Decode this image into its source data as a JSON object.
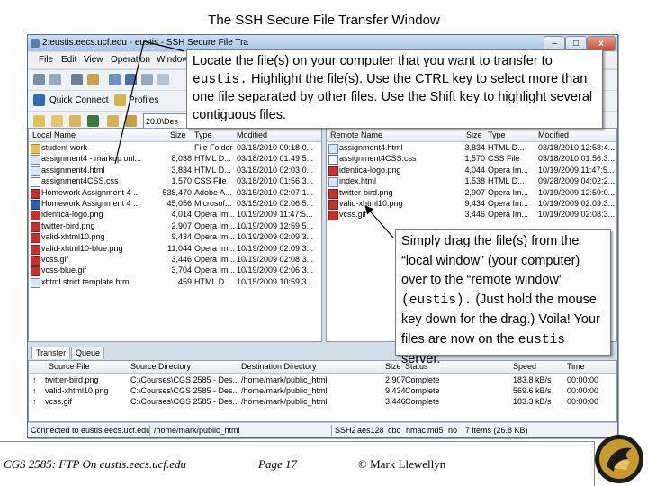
{
  "slide_title": "The SSH Secure File Transfer Window",
  "window": {
    "title": "2:eustis.eecs.ucf.edu - eustis - SSH Secure File Tra",
    "min": "–",
    "max": "□",
    "close": "x"
  },
  "menu": [
    "File",
    "Edit",
    "View",
    "Operation",
    "Window"
  ],
  "toolbar": {
    "quick_connect": "Quick Connect",
    "profiles": "Profiles",
    "path_value": "20.0\\Des"
  },
  "local_pane": {
    "headers": [
      "Local Name",
      "Size",
      "Type",
      "Modified"
    ],
    "rows": [
      {
        "icon": "folder-icon",
        "name": "student work",
        "size": "",
        "type": "File Folder",
        "modified": "03/18/2010 09:18:0..."
      },
      {
        "icon": "html-file-icon",
        "name": "assignment4 - markup onl...",
        "size": "8,038",
        "type": "HTML D...",
        "modified": "03/18/2010 01:49:5..."
      },
      {
        "icon": "html-file-icon",
        "name": "assignment4.html",
        "size": "3,834",
        "type": "HTML D...",
        "modified": "03/18/2010 02:03:0..."
      },
      {
        "icon": "css-file-icon",
        "name": "assignment4CSS.css",
        "size": "1,570",
        "type": "CSS File",
        "modified": "03/18/2010 01:56:3..."
      },
      {
        "icon": "pdf-file-icon",
        "name": "Homework Assignment 4 ...",
        "size": "538,470",
        "type": "Adobe A...",
        "modified": "03/15/2010 02:07:1..."
      },
      {
        "icon": "doc-file-icon",
        "name": "Homework Assignment 4 ...",
        "size": "45,056",
        "type": "Microsof...",
        "modified": "03/15/2010 02:06:5..."
      },
      {
        "icon": "image-file-icon",
        "name": "identica-logo.png",
        "size": "4,014",
        "type": "Opera Im...",
        "modified": "10/19/2009 11:47:5..."
      },
      {
        "icon": "image-file-icon",
        "name": "twitter-bird.png",
        "size": "2,907",
        "type": "Opera Im...",
        "modified": "10/19/2009 12:59:5..."
      },
      {
        "icon": "image-file-icon",
        "name": "valid-xhtml10.png",
        "size": "9,434",
        "type": "Opera Im...",
        "modified": "10/19/2009 02:09:3..."
      },
      {
        "icon": "image-file-icon",
        "name": "valid-xhtml10-blue.png",
        "size": "11,044",
        "type": "Opera Im...",
        "modified": "10/19/2009 02:09:3..."
      },
      {
        "icon": "image-file-icon",
        "name": "vcss.gif",
        "size": "3,446",
        "type": "Opera Im...",
        "modified": "10/19/2009 02:08:3..."
      },
      {
        "icon": "image-file-icon",
        "name": "vcss-blue.gif",
        "size": "3,704",
        "type": "Opera Im...",
        "modified": "10/19/2009 02:06:3..."
      },
      {
        "icon": "html-file-icon",
        "name": "xhtml strict template.html",
        "size": "459",
        "type": "HTML D...",
        "modified": "10/15/2009 10:59:3..."
      }
    ]
  },
  "remote_pane": {
    "headers": [
      "Remote Name",
      "Size",
      "Type",
      "Modified"
    ],
    "rows": [
      {
        "icon": "html-file-icon",
        "name": "assignment4.html",
        "size": "3,834",
        "type": "HTML D...",
        "modified": "03/18/2010 12:58:4..."
      },
      {
        "icon": "css-file-icon",
        "name": "assignment4CSS.css",
        "size": "1,570",
        "type": "CSS File",
        "modified": "03/18/2010 01:56:3..."
      },
      {
        "icon": "image-file-icon",
        "name": "identica-logo.png",
        "size": "4,044",
        "type": "Opera Im...",
        "modified": "10/19/2009 11:47:5..."
      },
      {
        "icon": "html-file-icon",
        "name": "index.html",
        "size": "1,538",
        "type": "HTML D...",
        "modified": "09/28/2009 04:02:2..."
      },
      {
        "icon": "image-file-icon",
        "name": "twitter-bird.png",
        "size": "2,907",
        "type": "Opera Im...",
        "modified": "10/19/2009 12:59:0..."
      },
      {
        "icon": "image-file-icon",
        "name": "valid-xhtml10.png",
        "size": "9,434",
        "type": "Opera Im...",
        "modified": "10/19/2009 02:09:3..."
      },
      {
        "icon": "image-file-icon",
        "name": "vcss.gif",
        "size": "3,446",
        "type": "Opera Im...",
        "modified": "10/19/2009 02:08:3..."
      }
    ]
  },
  "transfer_tabs": [
    "Transfer",
    "Queue"
  ],
  "transfer_pane": {
    "headers": [
      "Source File",
      "Source Directory",
      "Destination Directory",
      "Size",
      "Status",
      "Speed",
      "Time"
    ],
    "rows": [
      {
        "file": "twitter-bird.png",
        "src": "C:\\Courses\\CGS 2585 - Des...",
        "dest": "/home/mark/public_html",
        "size": "2,907",
        "status": "Complete",
        "speed": "183.8 kB/s",
        "time": "00:00:00"
      },
      {
        "file": "valid-xhtml10.png",
        "src": "C:\\Courses\\CGS 2585 - Des...",
        "dest": "/home/mark/public_html",
        "size": "9,434",
        "status": "Complete",
        "speed": "569.6 kB/s",
        "time": "00:00:00"
      },
      {
        "file": "vcss.gif",
        "src": "C:\\Courses\\CGS 2585 - Des...",
        "dest": "/home/mark/public_html",
        "size": "3,446",
        "status": "Complete",
        "speed": "183.3 kB/s",
        "time": "00:00:00"
      }
    ]
  },
  "status_bar": {
    "connection": "Connected to eustis.eecs.ucf.edu",
    "path": "/home/mark/public_html",
    "protocol": "SSH2",
    "cipher": "aes128",
    "mode": "cbc",
    "mac": "hmac",
    "hash": "md5",
    "compression": "no",
    "items": "7 items (26.8 KB)"
  },
  "callout1": {
    "line1": "Locate the file(s) on your computer that you want to transfer to",
    "mono1": "eustis.",
    "rest1": " Highlight the file(s).  Use the CTRL key to select more than one file separated by other files.  Use the  Shift key to highlight several contiguous files."
  },
  "callout2": {
    "part1": "Simply drag the file(s) from the “local window” (your computer) over to the “remote window”",
    "mono1": "(eustis).",
    "part2": "  (Just hold the mouse key down for the drag.)  Voila!  Your files are now on the",
    "mono2": "eustis",
    "part3": " server."
  },
  "footer": {
    "course": "CGS 2585:  FTP On eustis.eecs.ucf.edu",
    "page": "Page 17",
    "author": "© Mark Llewellyn"
  }
}
